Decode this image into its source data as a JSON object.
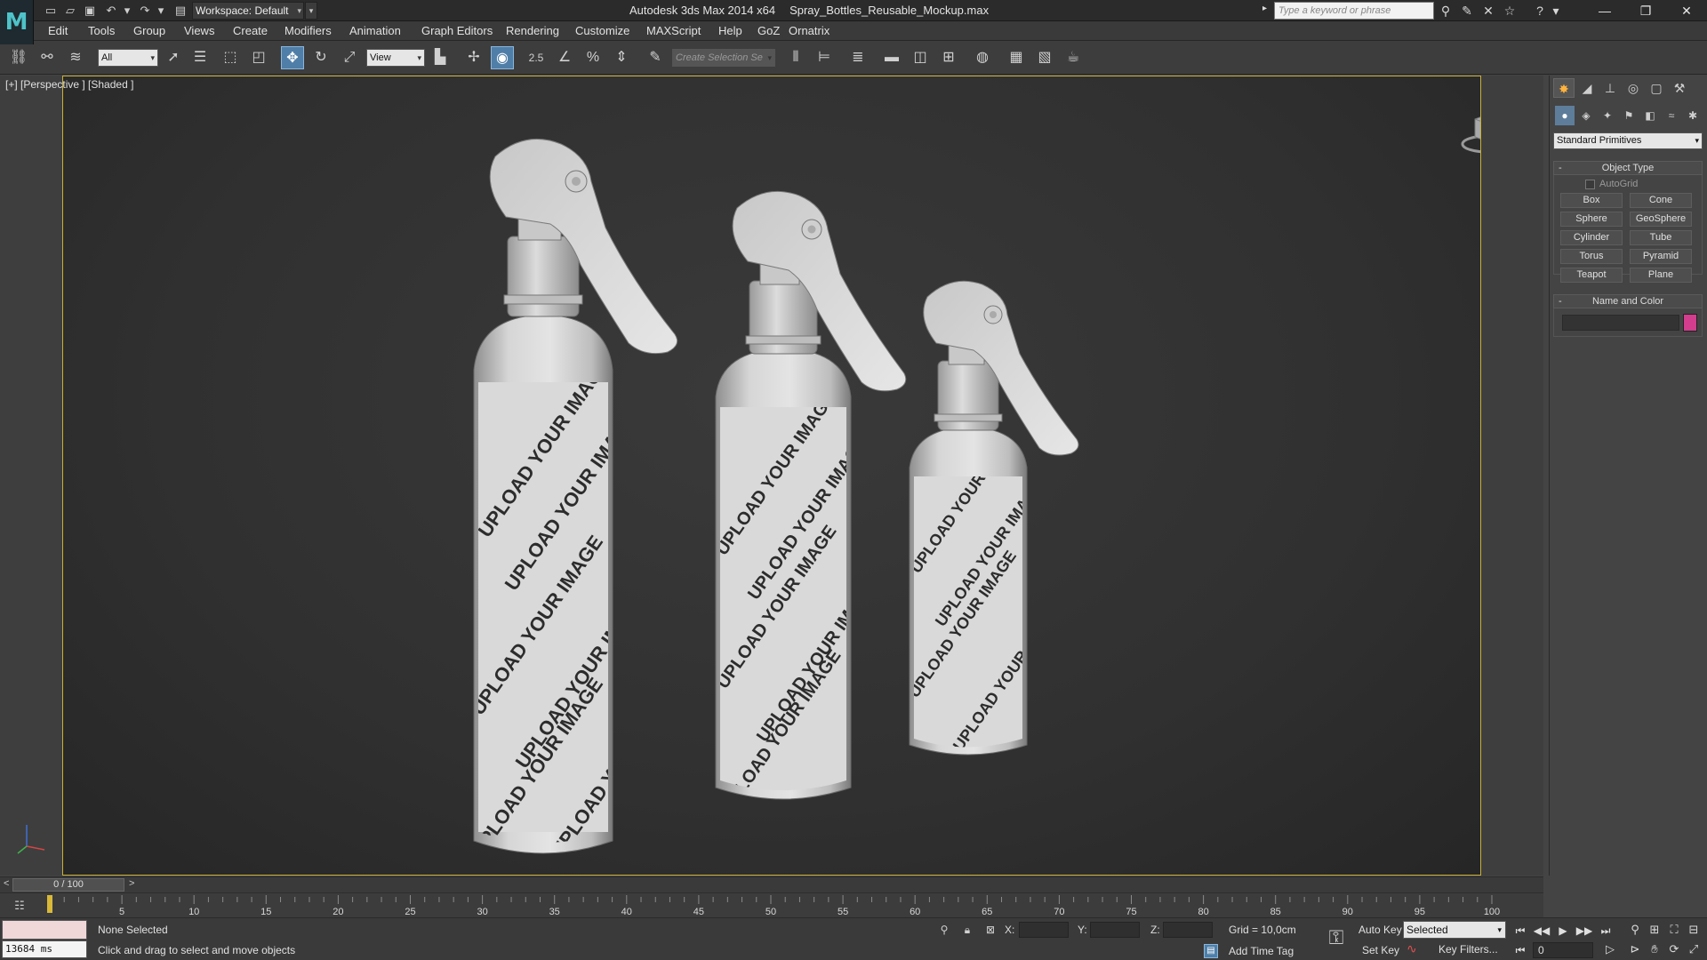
{
  "titlebar": {
    "workspace": "Workspace: Default",
    "app_name": "Autodesk 3ds Max  2014 x64",
    "file_name": "Spray_Bottles_Reusable_Mockup.max",
    "search_placeholder": "Type a keyword or phrase"
  },
  "menu": [
    "Edit",
    "Tools",
    "Group",
    "Views",
    "Create",
    "Modifiers",
    "Animation",
    "Graph Editors",
    "Rendering",
    "Customize",
    "MAXScript",
    "Help",
    "GoZ",
    "Ornatrix"
  ],
  "toolbar": {
    "selection_filter": "All",
    "ref_coord": "View",
    "snap_label": "2.5",
    "named_sel_placeholder": "Create Selection Se"
  },
  "viewport": {
    "label": "[+] [Perspective ] [Shaded ]",
    "label_texture": "UPLOAD YOUR IMAGE"
  },
  "command_panel": {
    "category": "Standard Primitives",
    "object_type_title": "Object Type",
    "autogrid": "AutoGrid",
    "buttons": [
      "Box",
      "Cone",
      "Sphere",
      "GeoSphere",
      "Cylinder",
      "Tube",
      "Torus",
      "Pyramid",
      "Teapot",
      "Plane"
    ],
    "name_color_title": "Name and Color",
    "color": "#d33d8e"
  },
  "timeline": {
    "frame_display": "0 / 100",
    "ticks": [
      "5",
      "10",
      "15",
      "20",
      "25",
      "30",
      "35",
      "40",
      "45",
      "50",
      "55",
      "60",
      "65",
      "70",
      "75",
      "80",
      "85",
      "90",
      "95",
      "100"
    ]
  },
  "status": {
    "listener_time": "13684 ms",
    "selection": "None Selected",
    "hint": "Click and drag to select and move objects",
    "x_label": "X:",
    "y_label": "Y:",
    "z_label": "Z:",
    "grid": "Grid = 10,0cm",
    "add_time_tag": "Add Time Tag",
    "auto_key": "Auto Key",
    "key_mode": "Selected",
    "set_key": "Set Key",
    "key_filters": "Key Filters...",
    "current_frame": "0"
  }
}
